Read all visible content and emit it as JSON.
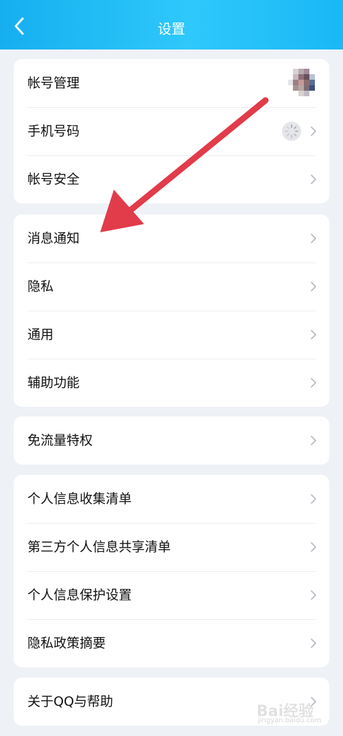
{
  "header": {
    "title": "设置"
  },
  "cards": [
    {
      "rows": [
        {
          "label": "帐号管理",
          "accessory": "avatar"
        },
        {
          "label": "手机号码",
          "accessory": "loading"
        },
        {
          "label": "帐号安全",
          "accessory": "chevron"
        }
      ]
    },
    {
      "rows": [
        {
          "label": "消息通知",
          "accessory": "chevron"
        },
        {
          "label": "隐私",
          "accessory": "chevron"
        },
        {
          "label": "通用",
          "accessory": "chevron"
        },
        {
          "label": "辅助功能",
          "accessory": "chevron"
        }
      ]
    },
    {
      "rows": [
        {
          "label": "免流量特权",
          "accessory": "chevron"
        }
      ]
    },
    {
      "rows": [
        {
          "label": "个人信息收集清单",
          "accessory": "chevron"
        },
        {
          "label": "第三方个人信息共享清单",
          "accessory": "chevron"
        },
        {
          "label": "个人信息保护设置",
          "accessory": "chevron"
        },
        {
          "label": "隐私政策摘要",
          "accessory": "chevron"
        }
      ]
    },
    {
      "rows": [
        {
          "label": "关于QQ与帮助",
          "accessory": "chevron"
        }
      ]
    }
  ],
  "annotation": {
    "icon": "red-arrow-icon",
    "color": "#e23b4a"
  },
  "watermark": {
    "brand": "Bai经验",
    "url": "jingyan.baidu.com"
  },
  "colors": {
    "header_start": "#15aff0",
    "header_end": "#2ec8fb",
    "background": "#eef1f6",
    "chevron": "#b7bcc4"
  }
}
